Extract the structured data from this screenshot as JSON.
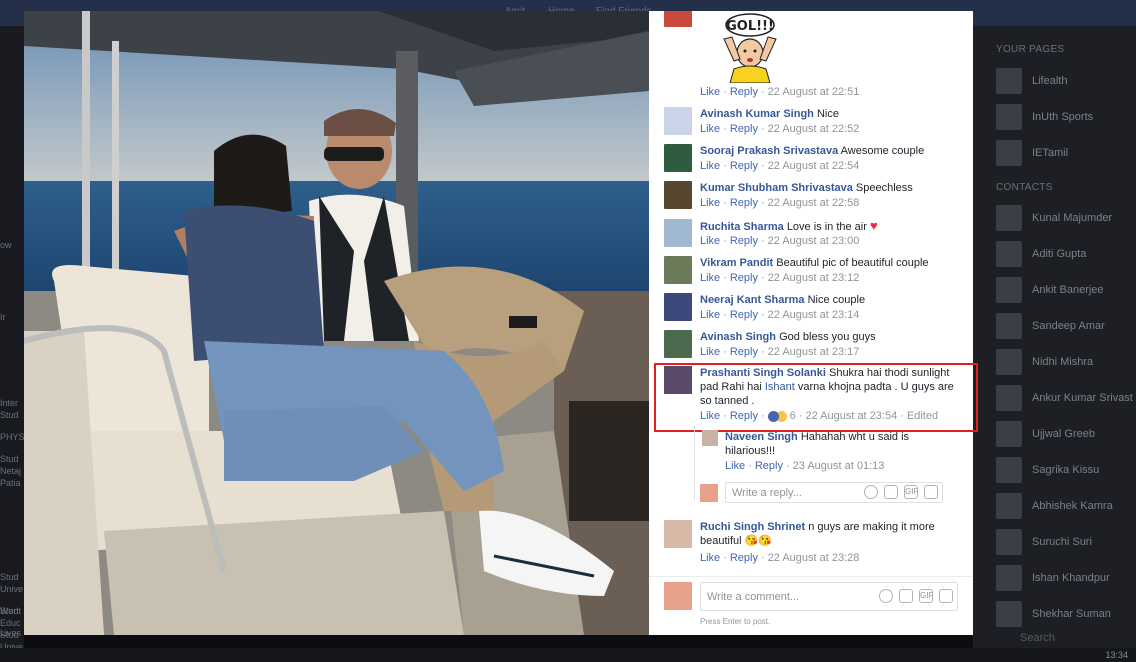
{
  "comments": [
    {
      "name": "",
      "text": "",
      "time": "22 August at 22:51",
      "sticker": "GOL!!!"
    },
    {
      "name": "Avinash Kumar Singh",
      "text": "Nice",
      "time": "22 August at 22:52"
    },
    {
      "name": "Sooraj Prakash Srivastava",
      "text": "Awesome couple",
      "time": "22 August at 22:54"
    },
    {
      "name": "Kumar Shubham Shrivastava",
      "text": "Speechless",
      "time": "22 August at 22:58"
    },
    {
      "name": "Ruchita Sharma",
      "text": "Love is in the air",
      "time": "22 August at 23:00"
    },
    {
      "name": "Vikram Pandit",
      "text": "Beautiful pic of beautiful couple",
      "time": "22 August at 23:12"
    },
    {
      "name": "Neeraj Kant Sharma",
      "text": "Nice couple",
      "time": "22 August at 23:14"
    },
    {
      "name": "Avinash Singh",
      "text": "God bless you guys",
      "time": "22 August at 23:17"
    }
  ],
  "highlighted": {
    "name": "Prashanti Singh Solanki",
    "text_a": "Shukra hai thodi sunlight pad Rahi hai",
    "tag": "Ishant",
    "text_b": "varna khojna padta . U guys are so tanned .",
    "reactions": "6",
    "time": "22 August at 23:54",
    "edited": "Edited"
  },
  "reply": {
    "name": "Naveen Singh",
    "text": "Hahahah wht u said is hilarious!!!",
    "time": "23 August at 01:13",
    "input_placeholder": "Write a reply..."
  },
  "last_comment": {
    "name": "Ruchi Singh Shrinet",
    "text": "n guys are making it more beautiful",
    "time": "22 August at 23:28"
  },
  "actions": {
    "like": "Like",
    "reply": "Reply"
  },
  "comment_input": {
    "placeholder": "Write a comment...",
    "hint": "Press Enter to post."
  },
  "icons": {
    "gif": "GIF"
  },
  "right_rail": {
    "your_pages_heading": "YOUR PAGES",
    "pages": [
      "Lifealth",
      "InUth Sports",
      "IETamil"
    ],
    "contacts_heading": "CONTACTS",
    "contacts": [
      "Kunal Majumder",
      "Aditi Gupta",
      "Ankit Banerjee",
      "Sandeep Amar",
      "Nidhi Mishra",
      "Ankur Kumar Srivast",
      "Ujjwal Greeb",
      "Sagrika Kissu",
      "Abhishek Kamra",
      "Suruchi Suri",
      "Ishan Khandpur",
      "Shekhar Suman"
    ],
    "search": "Search"
  },
  "left_fragments": [
    "ow",
    "Ir",
    "Inter",
    "Stud",
    "PHYS",
    "Stud",
    "Netaj",
    "Patia",
    "Stud",
    "Unive",
    "Stud",
    "Educ",
    "Stud",
    "Unive",
    "Went",
    "Lives"
  ],
  "top_nav": [
    "Amit",
    "Home",
    "Find Friends"
  ],
  "taskbar_time": "13:34",
  "colors": {
    "link": "#365899",
    "accent": "#4267b2",
    "highlight_border": "#e02020"
  }
}
